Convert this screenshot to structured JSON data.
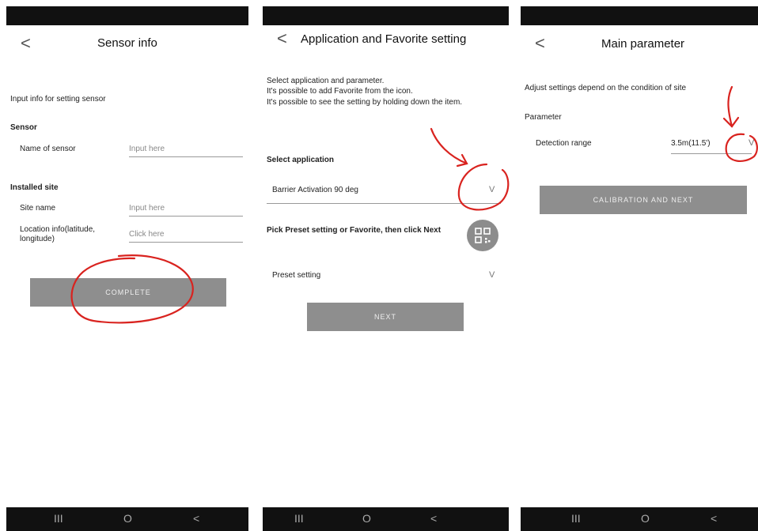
{
  "screen1": {
    "back_glyph": "<",
    "title": "Sensor info",
    "intro": "Input info for setting sensor",
    "sensor_header": "Sensor",
    "name_label": "Name of sensor",
    "name_placeholder": "Input here",
    "installed_header": "Installed site",
    "site_label": "Site name",
    "site_placeholder": "Input here",
    "location_label_1": "Location info(latitude,",
    "location_label_2": "longitude)",
    "location_placeholder": "Click here",
    "complete_button": "COMPLETE"
  },
  "screen2": {
    "back_glyph": "<",
    "title": "Application and Favorite setting",
    "desc_1": "Select application and parameter.",
    "desc_2": "It's possible to add Favorite from the icon.",
    "desc_3": "It's possible to see the setting by holding down the item.",
    "select_app_header": "Select application",
    "app_value": "Barrier Activation 90 deg",
    "pick_text": "Pick Preset setting or Favorite, then click Next",
    "preset_value": "Preset setting",
    "next_button": "NEXT"
  },
  "screen3": {
    "back_glyph": "<",
    "title": "Main parameter",
    "desc": "Adjust settings depend on the condition of site",
    "param_header": "Parameter",
    "detection_label": "Detection range",
    "detection_value": "3.5m(11.5')",
    "calibration_button": "CALIBRATION AND NEXT"
  },
  "navbar": {
    "recents": "III",
    "home": "O",
    "back": "<"
  },
  "chevron": "V",
  "annotation_color": "#d9231f",
  "button_color": "#8e8e8e",
  "icons": [
    "back-chevron-icon",
    "dropdown-chevron-icon",
    "qr-code-icon",
    "nav-recents-icon",
    "nav-home-icon",
    "nav-back-icon"
  ]
}
